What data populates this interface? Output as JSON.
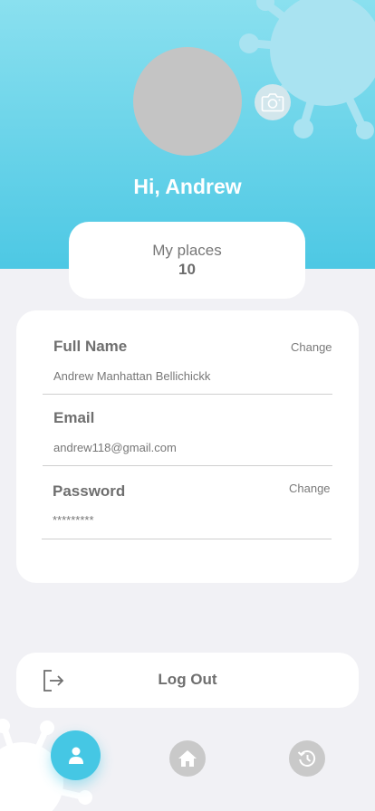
{
  "header": {
    "greeting": "Hi, Andrew",
    "accent_color": "#4dc8e4"
  },
  "places": {
    "label": "My places",
    "count": "10"
  },
  "profile": {
    "full_name": {
      "title": "Full Name",
      "value": "Andrew Manhattan Bellichickk",
      "action": "Change"
    },
    "email": {
      "title": "Email",
      "value": "andrew118@gmail.com"
    },
    "password": {
      "title": "Password",
      "value": "*********",
      "action": "Change"
    }
  },
  "logout": {
    "label": "Log Out",
    "icon": "logout-icon"
  },
  "nav": {
    "items": [
      {
        "icon": "user-icon",
        "active": true
      },
      {
        "icon": "home-icon",
        "active": false
      },
      {
        "icon": "history-icon",
        "active": false
      }
    ]
  }
}
